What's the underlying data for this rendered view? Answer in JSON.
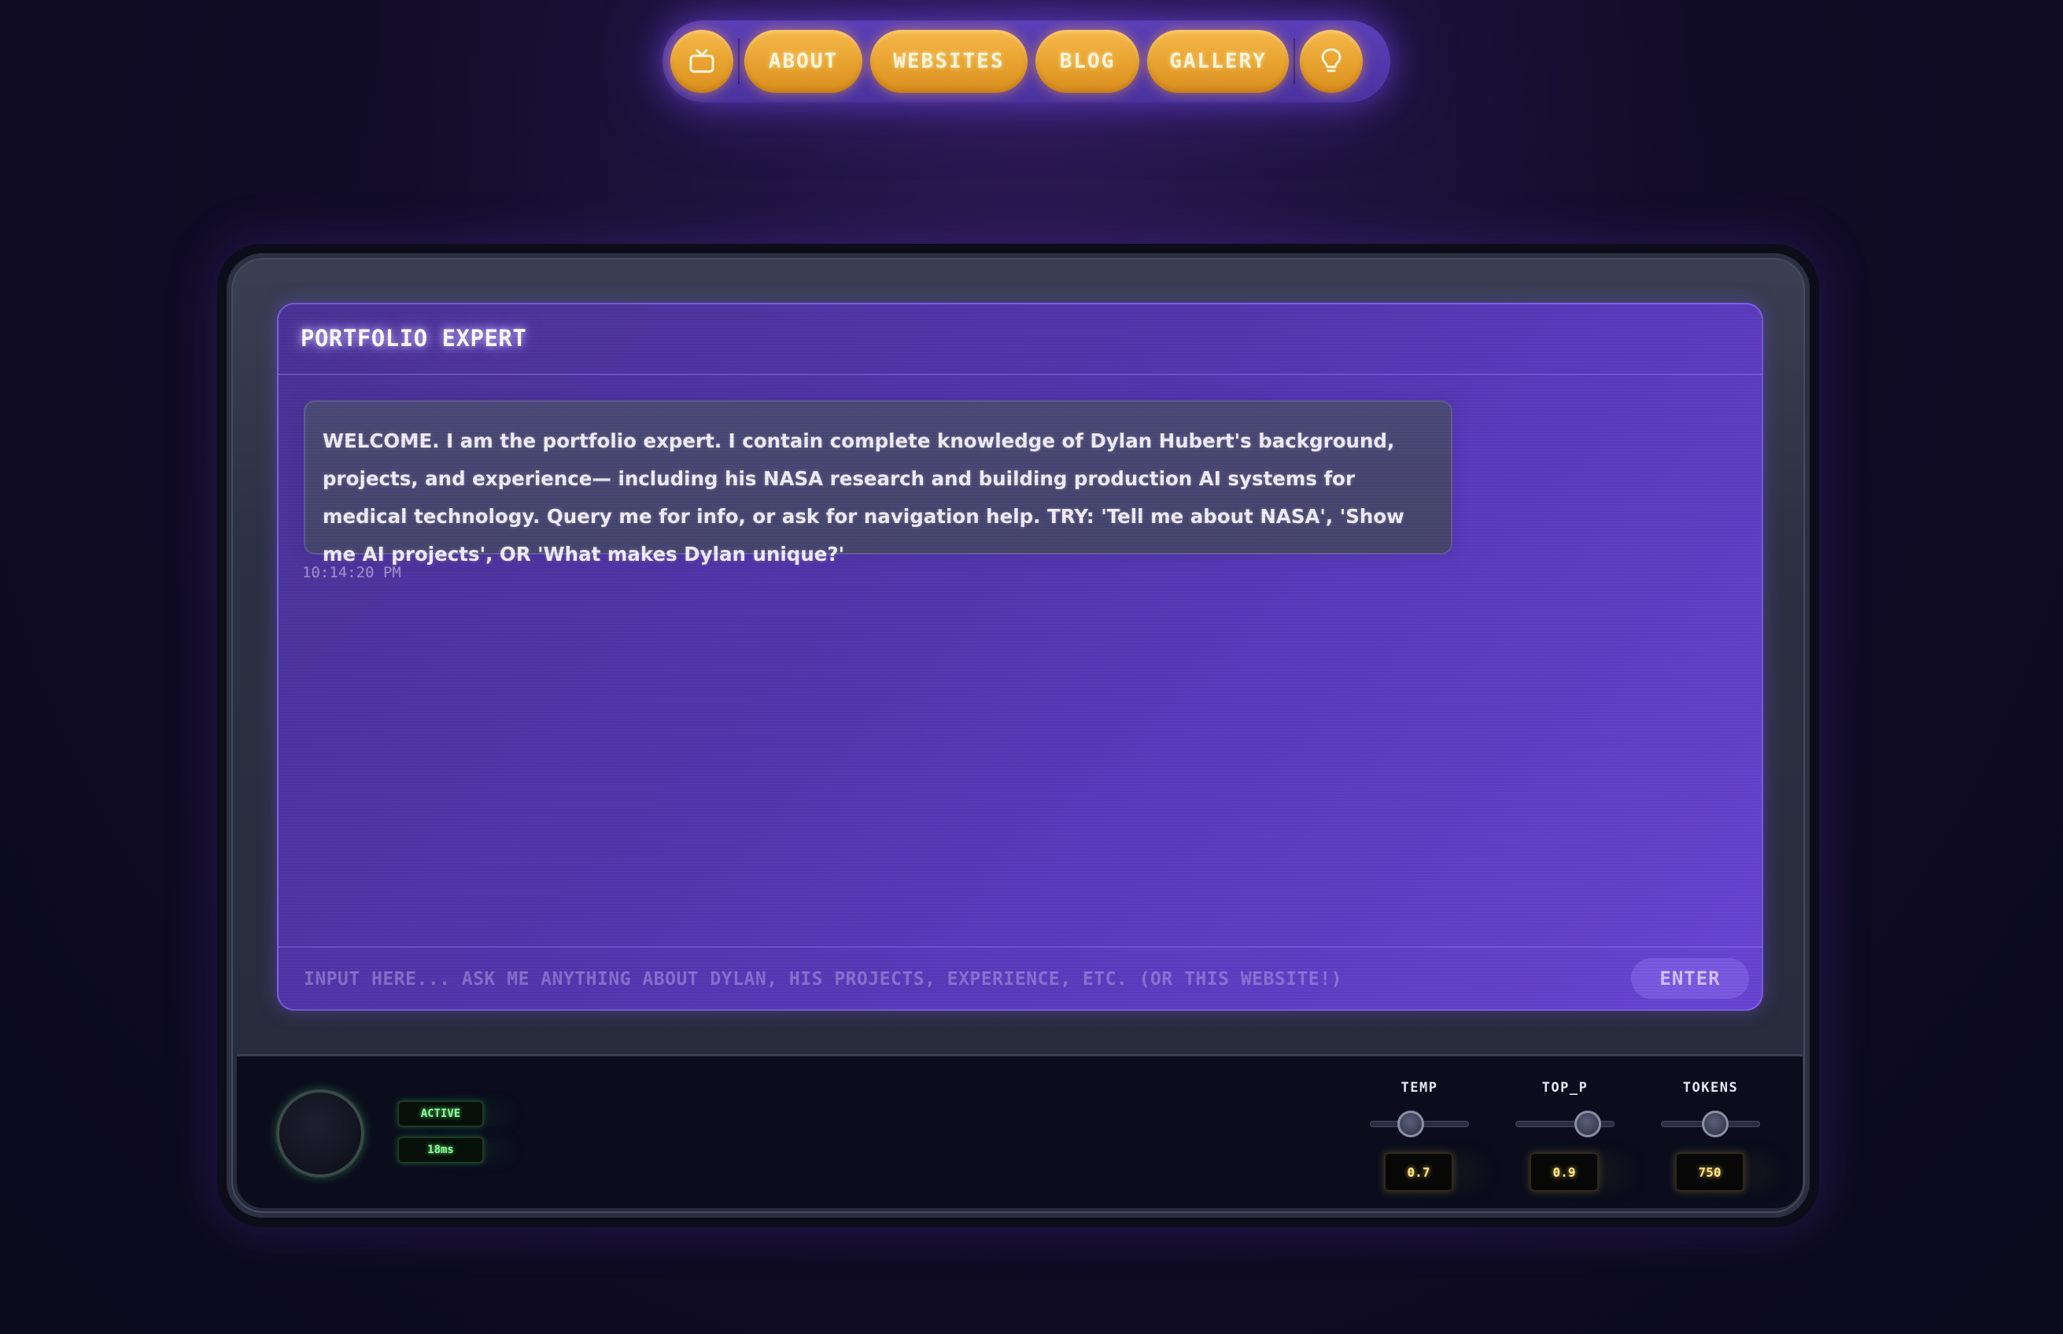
{
  "nav": {
    "items": [
      {
        "label": "ABOUT"
      },
      {
        "label": "WEBSITES"
      },
      {
        "label": "BLOG"
      },
      {
        "label": "GALLERY"
      }
    ],
    "home_icon": "tv-icon",
    "theme_icon": "lightbulb-icon"
  },
  "chat": {
    "title": "PORTFOLIO EXPERT",
    "messages": [
      {
        "text": "WELCOME. I am the portfolio expert. I contain complete knowledge of Dylan Hubert's background, projects, and experience— including his NASA research and building production AI systems for medical technology. Query me for info, or ask for navigation help. TRY: 'Tell me about NASA', 'Show me AI projects', OR 'What makes Dylan unique?'",
        "time": "10:14:20 PM"
      }
    ],
    "input_placeholder": "INPUT HERE... ASK ME ANYTHING ABOUT DYLAN, HIS PROJECTS, EXPERIENCE, ETC. (OR THIS WEBSITE!)",
    "input_value": "",
    "submit_label": "ENTER"
  },
  "panel": {
    "status": "ACTIVE",
    "latency": "18ms",
    "controls": {
      "temp": {
        "label": "TEMP",
        "value": "0.7",
        "level": 0.38
      },
      "top_p": {
        "label": "TOP_P",
        "value": "0.9",
        "level": 0.82
      },
      "tokens": {
        "label": "TOKENS",
        "value": "750",
        "level": 0.56
      }
    }
  },
  "colors": {
    "accent": "#f0a83a",
    "screen": "#5a3ab8",
    "led_green": "#8dff9a",
    "led_amber": "#ffe68a"
  }
}
